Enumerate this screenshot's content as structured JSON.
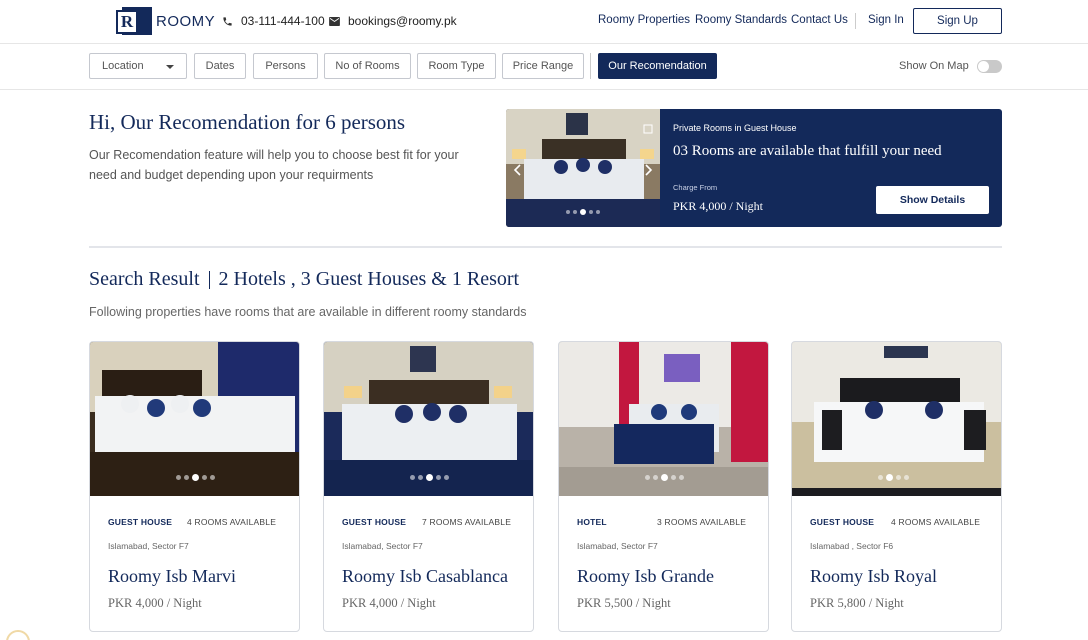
{
  "brand": {
    "name": "ROOMY",
    "mark": "R"
  },
  "header": {
    "phone": "03-111-444-100",
    "email": "bookings@roomy.pk",
    "nav": [
      "Roomy Properties",
      "Roomy Standards",
      "Contact Us"
    ],
    "sign_in": "Sign In",
    "sign_up": "Sign Up"
  },
  "filters": {
    "location": "Location",
    "dates": "Dates",
    "persons": "Persons",
    "no_of_rooms": "No of Rooms",
    "room_type": "Room Type",
    "price_range": "Price Range",
    "recommendation": "Our Recomendation",
    "show_on_map": "Show On Map",
    "show_on_map_enabled": false
  },
  "recommendation": {
    "title": "Hi, Our Recomendation for 6 persons",
    "description": "Our Recomendation feature will help you to choose best fit for your need and budget depending  upon your requirments",
    "card": {
      "label": "Private Rooms in Guest House",
      "headline": "03 Rooms are available that fulfill your need",
      "charge_from": "Charge From",
      "price": "PKR 4,000 / Night",
      "button": "Show Details"
    }
  },
  "results": {
    "title_left": "Search Result",
    "title_right": "2 Hotels , 3 Guest Houses & 1 Resort",
    "description": "Following properties have rooms that are available in different roomy standards",
    "cards": [
      {
        "type": "GUEST HOUSE",
        "rooms": "4 ROOMS AVAILABLE",
        "location": "Islamabad, Sector F7",
        "name": "Roomy Isb Marvi",
        "price": "PKR 4,000 / Night"
      },
      {
        "type": "GUEST HOUSE",
        "rooms": "7 ROOMS AVAILABLE",
        "location": "Islamabad, Sector F7",
        "name": "Roomy Isb Casablanca",
        "price": "PKR 4,000 / Night"
      },
      {
        "type": "HOTEL",
        "rooms": "3 ROOMS AVAILABLE",
        "location": "Islamabad, Sector F7",
        "name": "Roomy Isb Grande",
        "price": "PKR 5,500 / Night"
      },
      {
        "type": "GUEST HOUSE",
        "rooms": "4 ROOMS AVAILABLE",
        "location": "Islamabad , Sector F6",
        "name": "Roomy Isb Royal",
        "price": "PKR 5,800 / Night"
      }
    ]
  },
  "colors": {
    "primary": "#13295a",
    "border": "#c5c8cf",
    "text_muted": "#666666"
  },
  "icons": [
    "phone-icon",
    "mail-icon",
    "chevron-down-icon",
    "arrow-left-icon",
    "arrow-right-icon",
    "expand-icon"
  ]
}
